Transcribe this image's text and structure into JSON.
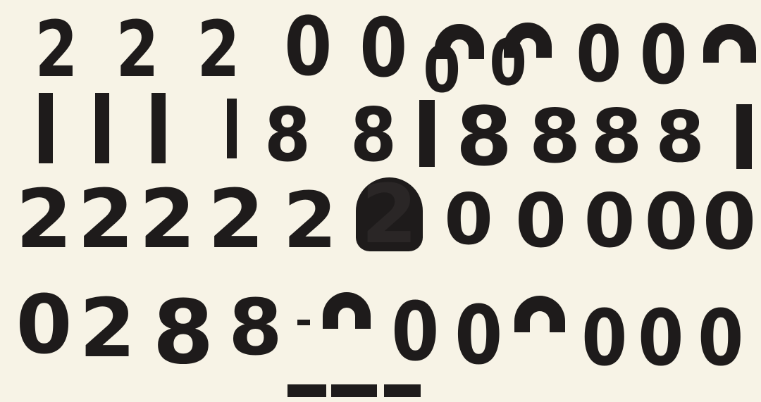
{
  "rows": [
    {
      "id": "row1",
      "glyphs": [
        "2",
        "2",
        "2",
        "0",
        "0",
        "0",
        "0",
        "0",
        "0"
      ]
    },
    {
      "id": "row2",
      "glyphs": [
        "1",
        "1",
        "1",
        "1",
        "8",
        "8",
        "1",
        "8",
        "8",
        "8",
        "8",
        "1"
      ]
    },
    {
      "id": "row3",
      "glyphs": [
        "2",
        "2",
        "2",
        "2",
        "2",
        "2",
        "0",
        "0",
        "0",
        "0",
        "0"
      ]
    },
    {
      "id": "row4",
      "glyphs": [
        "0",
        "2",
        "8",
        "8",
        "0",
        "0",
        "0",
        "0",
        "0"
      ]
    }
  ],
  "ink_color": "#1e1b1b",
  "paper_color": "#f7f3e6"
}
